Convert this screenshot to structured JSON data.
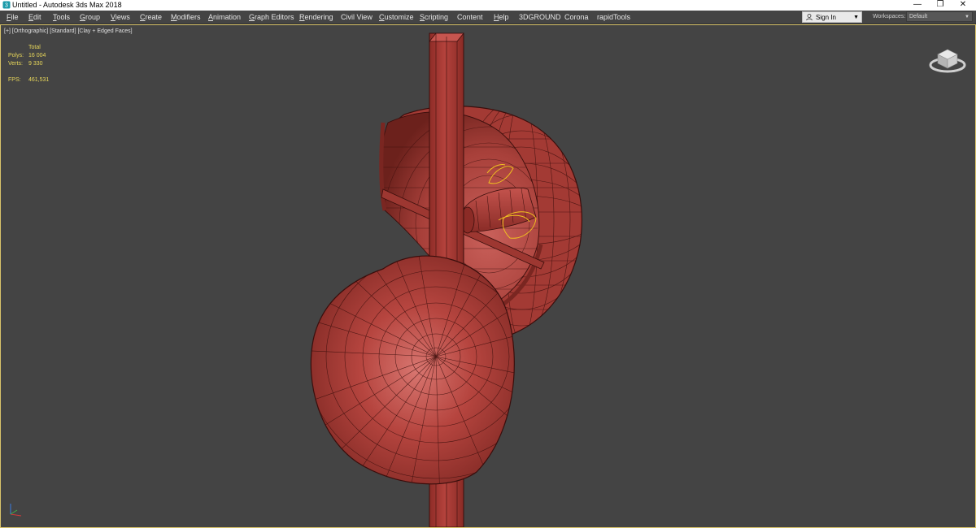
{
  "window": {
    "title": "Untitled - Autodesk 3ds Max 2018",
    "app_icon": "3ds-max-logo-icon",
    "controls": {
      "minimize": "—",
      "restore": "❐",
      "close": "✕"
    }
  },
  "menubar": {
    "items": [
      {
        "ul": "F",
        "rest": "ile"
      },
      {
        "ul": "E",
        "rest": "dit"
      },
      {
        "ul": "T",
        "rest": "ools"
      },
      {
        "ul": "G",
        "rest": "roup"
      },
      {
        "ul": "V",
        "rest": "iews"
      },
      {
        "ul": "C",
        "rest": "reate"
      },
      {
        "ul": "M",
        "rest": "odifiers"
      },
      {
        "ul": "A",
        "rest": "nimation"
      },
      {
        "ul": "G",
        "rest": "raph Editors"
      },
      {
        "ul": "R",
        "rest": "endering"
      },
      {
        "ul": "",
        "rest": "Civil View"
      },
      {
        "ul": "C",
        "rest": "ustomize"
      },
      {
        "ul": "S",
        "rest": "cripting"
      },
      {
        "ul": "",
        "rest": "Content"
      },
      {
        "ul": "H",
        "rest": "elp"
      },
      {
        "ul": "",
        "rest": "3DGROUND"
      },
      {
        "ul": "",
        "rest": "Corona"
      },
      {
        "ul": "",
        "rest": "rapidTools"
      }
    ],
    "sign_in": {
      "label": "Sign In",
      "icon": "user-icon"
    },
    "workspaces": {
      "label": "Workspaces:",
      "value": "Default"
    }
  },
  "viewport": {
    "label": "[+] [Orthographic] [Standard] [Clay + Edged Faces]",
    "stats": {
      "header": "Total",
      "polys_label": "Polys:",
      "polys_value": "16 004",
      "verts_label": "Verts:",
      "verts_value": "9 330",
      "fps_label": "FPS:",
      "fps_value": "461,531"
    },
    "colors": {
      "background": "#444444",
      "clay": "#b3423d",
      "clay_dark": "#7a2621",
      "wire": "#3a0e0c",
      "selection": "#f0c020",
      "stats_text": "#e8d75a"
    }
  }
}
